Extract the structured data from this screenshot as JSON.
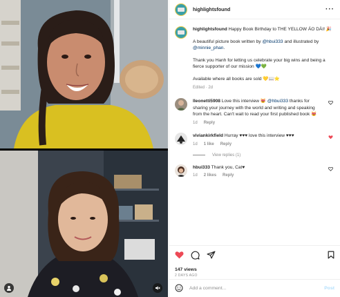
{
  "header": {
    "handle": "highlightsfound",
    "more": "···"
  },
  "post": {
    "handle": "highlightsfound",
    "caption": "Happy Book Birthday to THE YELLOW ÁO DÀI! 🎉",
    "para2_prefix": "A beautiful picture book written by ",
    "author": "@hbui333",
    "para2_mid": " and illustrated by ",
    "illustrator": "@minnie_phan",
    "para2_suffix": ".",
    "para3": "Thank you Hanh for letting us celebrate your big wins and being a fierce supporter of our mission 💙💚",
    "para4": "Available where all books are sold 💛📖⭐",
    "meta": "Edited · 2d"
  },
  "comments": [
    {
      "user": "lleonetti5908",
      "text_a": " Love this interview 😻 ",
      "mention": "@hbui333",
      "text_b": " thanks for sharing your journey with the world and writing and speaking from the heart. Can't wait to read your first published book 😻",
      "time": "1d",
      "likes": "",
      "reply": "Reply",
      "liked": false
    },
    {
      "user": "viviankirkfield",
      "text": " Hurray ♥♥♥ love this interview ♥♥♥",
      "time": "1d",
      "likes": "1 like",
      "reply": "Reply",
      "liked": true,
      "view_replies": "View replies (1)"
    },
    {
      "user": "hbui333",
      "text": " Thank you, Cat♥",
      "time": "1d",
      "likes": "2 likes",
      "reply": "Reply",
      "liked": false
    }
  ],
  "stats": {
    "views": "147 views",
    "date": "2 DAYS AGO"
  },
  "add_comment": {
    "placeholder": "Add a comment...",
    "post_label": "Post"
  },
  "colors": {
    "like_red": "#ed4956",
    "link_blue": "#00376b",
    "post_blue": "#b2dffc"
  }
}
